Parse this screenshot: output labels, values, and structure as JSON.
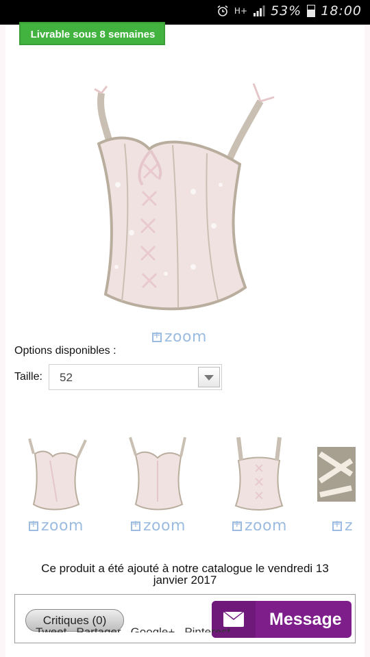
{
  "status_bar": {
    "alarm_icon": "alarm-clock-icon",
    "network_type": "H+",
    "battery_percent": "53%",
    "time": "18:00"
  },
  "badge": {
    "label": "Livrable sous 8 semaines",
    "color": "#43b33f"
  },
  "product": {
    "main_image": "pink-lace-corset-front",
    "zoom_label": "zoom",
    "options_label": "Options disponibles :",
    "size_label": "Taille:",
    "size_value": "52",
    "thumbnails": [
      {
        "image": "corset-front-thumb",
        "zoom_label": "zoom"
      },
      {
        "image": "corset-front-alt-thumb",
        "zoom_label": "zoom"
      },
      {
        "image": "corset-back-thumb",
        "zoom_label": "zoom"
      },
      {
        "image": "corset-detail-thumb",
        "zoom_label": "z"
      }
    ],
    "catalog_line1": "Ce produit a été ajouté à notre catalogue le  vendredi 13",
    "catalog_line2": "janvier 2017"
  },
  "reviews": {
    "critiques_label": "Critiques (0)",
    "message_label": "Message",
    "accent": "#7d1e8a"
  },
  "share": [
    "Tweet",
    "Partager",
    "Google+",
    "Pinterest"
  ]
}
